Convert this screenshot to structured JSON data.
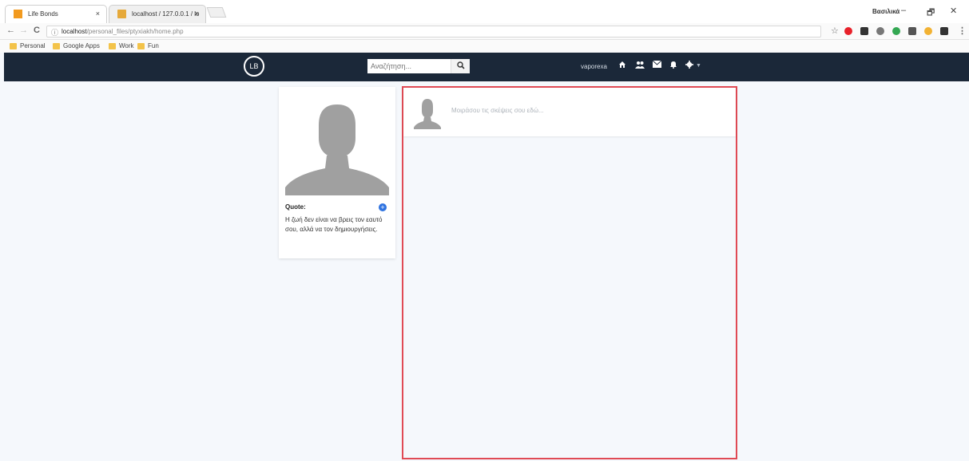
{
  "browser": {
    "tabs": [
      {
        "title": "Life Bonds",
        "close": "×"
      },
      {
        "title": "localhost / 127.0.0.1 / lo",
        "close": "×"
      }
    ],
    "user": "Βασιλικά",
    "window_controls": [
      "–",
      "🗗",
      "✕"
    ],
    "nav": {
      "back": "←",
      "forward": "→",
      "reload": "C"
    },
    "url": {
      "host": "localhost",
      "path": "/personal_files/ptyxiakh/home.php"
    },
    "bookmarks": [
      "Personal",
      "Google Apps",
      "Work",
      "Fun"
    ],
    "extension_colors": [
      "#e8212a",
      "#333333",
      "#777777",
      "#34a853",
      "#555555",
      "#f2b233",
      "#333333"
    ]
  },
  "site": {
    "logo": "LB",
    "search": {
      "placeholder": "Αναζήτηση...",
      "button": "🔍"
    },
    "username": "vaporexa",
    "icons": [
      "home-icon",
      "users-icon",
      "envelope-icon",
      "bell-icon",
      "gear-icon"
    ]
  },
  "profile": {
    "quote_label": "Quote:",
    "quote_add": "+",
    "quote_text": "Η ζωή δεν είναι να βρεις τον εαυτό σου, αλλά να τον δημιουργήσεις."
  },
  "feed": {
    "composer_placeholder": "Μοιράσου τις σκέψεις σου εδώ..."
  },
  "colors": {
    "navbar": "#1b2839",
    "page_bg": "#f5f8fc",
    "highlight_border": "#e04a55",
    "accent": "#2f73e0"
  }
}
